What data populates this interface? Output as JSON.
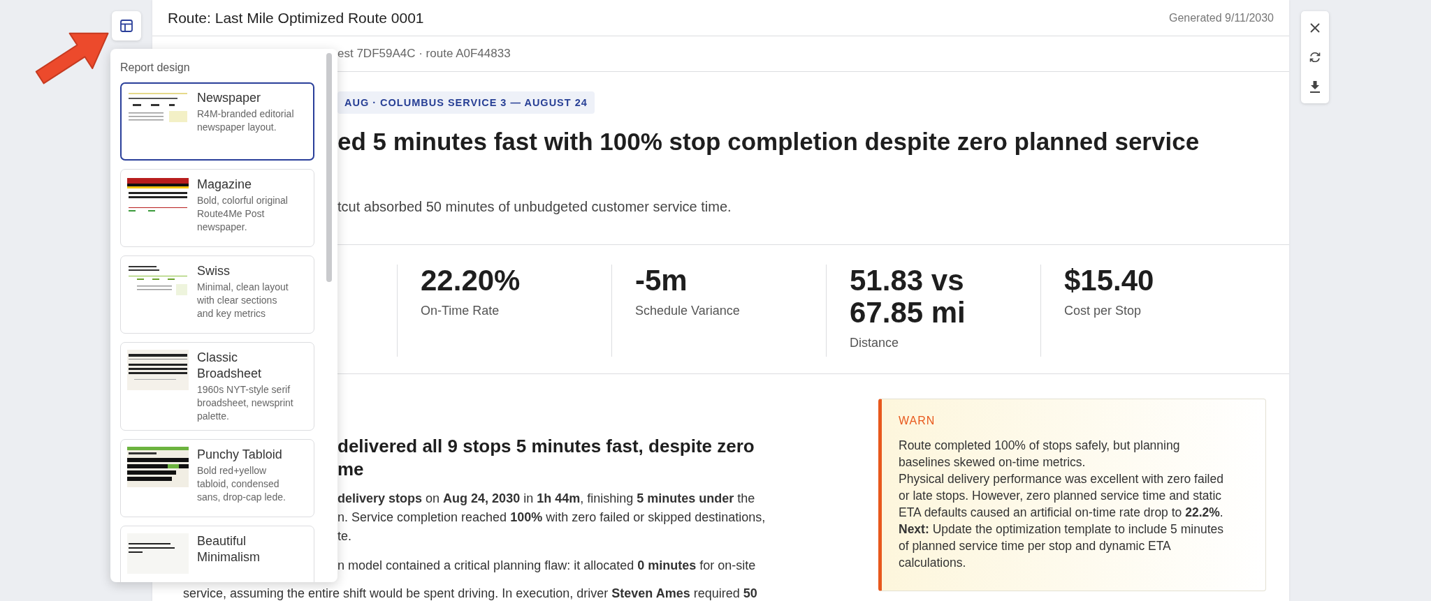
{
  "design_menu": {
    "title": "Report design",
    "designs": [
      {
        "name": "Newspaper",
        "description": "R4M-branded editorial newspaper layout.",
        "kind": "newspaper",
        "selected": true
      },
      {
        "name": "Magazine",
        "description": "Bold, colorful original Route4Me Post newspaper.",
        "kind": "magazine",
        "selected": false
      },
      {
        "name": "Swiss",
        "description": "Minimal, clean layout with clear sections and key metrics",
        "kind": "swiss",
        "selected": false
      },
      {
        "name": "Classic Broadsheet",
        "description": "1960s NYT-style serif broadsheet, newsprint palette.",
        "kind": "broadsheet",
        "selected": false
      },
      {
        "name": "Punchy Tabloid",
        "description": "Bold red+yellow tabloid, condensed sans, drop-cap lede.",
        "kind": "tabloid",
        "selected": false
      },
      {
        "name": "Beautiful Minimalism",
        "kind": "minimal",
        "selected": false
      }
    ]
  },
  "report": {
    "title": "Route: Last Mile Optimized Route 0001",
    "generated": "Generated 9/11/2030",
    "meta": "est 7DF59A4C · route A0F44833",
    "tag": "AUG · COLUMBUS SERVICE 3 — AUGUST 24",
    "headline": "ed 5 minutes fast with 100% stop completion despite zero planned service",
    "subtitle": "tcut absorbed 50 minutes of unbudgeted customer service time.",
    "kpis": [
      {
        "value": "22.20%",
        "label": "On-Time Rate"
      },
      {
        "value": "-5m",
        "label": "Schedule Variance"
      },
      {
        "value": "51.83 vs 67.85 mi",
        "label": "Distance"
      },
      {
        "value": "$15.40",
        "label": "Cost per Stop"
      }
    ],
    "article": {
      "heading_lines": [
        "delivered all 9 stops 5 minutes fast, despite zero",
        "me"
      ],
      "paragraphs": [
        [
          "**delivery stops** on **Aug 24, 2030** in **1h 44m**, finishing **5 minutes under** the",
          "n. Service completion reached **100%** with zero failed or skipped destinations,",
          "te."
        ],
        [
          "n model contained a critical planning flaw: it allocated **0 minutes** for on-site"
        ]
      ],
      "bottom_line": "service, assuming the entire shift would be spent driving. In execution, driver **Steven Ames** required **50**"
    },
    "alert": {
      "kind": "warn",
      "label": "WARN",
      "paragraphs": [
        "Route completed 100% of stops safely, but planning baselines skewed on-time metrics.",
        "Physical delivery performance was excellent with zero failed or late stops. However, zero planned service time and static ETA defaults caused an artificial on-time rate drop to **22.2%**.",
        "**Next:** Update the optimization template to include 5 minutes of planned service time per stop and dynamic ETA calculations."
      ]
    }
  }
}
